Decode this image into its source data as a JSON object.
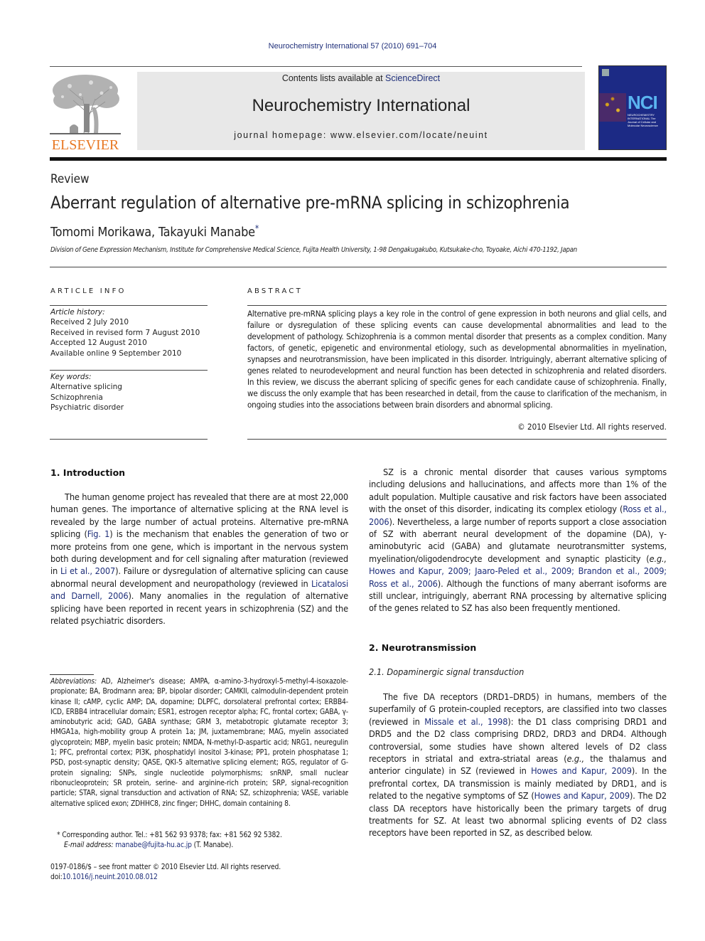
{
  "header": {
    "citation": "Neurochemistry International 57 (2010) 691–704",
    "contents_prefix": "Contents lists available at ",
    "contents_link": "ScienceDirect",
    "journal_title": "Neurochemistry International",
    "homepage": "journal homepage: www.elsevier.com/locate/neuint",
    "publisher_logo_text": "ELSEVIER",
    "cover": {
      "acronym": "NCI",
      "subtitle": "NEUROCHEMISTRY INTERNATIONAL The Journal of Cellular and Molecular Neuroscience"
    }
  },
  "article": {
    "type": "Review",
    "title": "Aberrant regulation of alternative pre-mRNA splicing in schizophrenia",
    "authors": "Tomomi Morikawa, Takayuki Manabe",
    "author_mark": "*",
    "affiliation": "Division of Gene Expression Mechanism, Institute for Comprehensive Medical Science, Fujita Health University, 1-98 Dengakugakubo, Kutsukake-cho, Toyoake, Aichi 470-1192, Japan"
  },
  "article_info": {
    "heading": "ARTICLE INFO",
    "history_label": "Article history:",
    "history": [
      "Received 2 July 2010",
      "Received in revised form 7 August 2010",
      "Accepted 12 August 2010",
      "Available online 9 September 2010"
    ],
    "keywords_label": "Key words:",
    "keywords": [
      "Alternative splicing",
      "Schizophrenia",
      "Psychiatric disorder"
    ]
  },
  "abstract": {
    "heading": "ABSTRACT",
    "text": "Alternative pre-mRNA splicing plays a key role in the control of gene expression in both neurons and glial cells, and failure or dysregulation of these splicing events can cause developmental abnormalities and lead to the development of pathology. Schizophrenia is a common mental disorder that presents as a complex condition. Many factors, of genetic, epigenetic and environmental etiology, such as developmental abnormalities in myelination, synapses and neurotransmission, have been implicated in this disorder. Intriguingly, aberrant alternative splicing of genes related to neurodevelopment and neural function has been detected in schizophrenia and related disorders. In this review, we discuss the aberrant splicing of specific genes for each candidate cause of schizophrenia. Finally, we discuss the only example that has been researched in detail, from the cause to clarification of the mechanism, in ongoing studies into the associations between brain disorders and abnormal splicing.",
    "copyright": "© 2010 Elsevier Ltd. All rights reserved."
  },
  "body": {
    "intro_heading": "1.  Introduction",
    "intro_p1": [
      "The human genome project has revealed that there are at most 22,000 human genes. The importance of alternative splicing at the RNA level is revealed by the large number of actual proteins. Alternative pre-mRNA splicing (",
      "Fig. 1",
      ") is the mechanism that enables the generation of two or more proteins from one gene, which is important in the nervous system both during development and for cell signaling after maturation (reviewed in ",
      "Li et al., 2007",
      "). Failure or dysregulation of alternative splicing can cause abnormal neural development and neuropathology (reviewed in ",
      "Licatalosi and Darnell, 2006",
      "). Many anomalies in the regulation of alternative splicing have been reported in recent years in schizophrenia (SZ) and the related psychiatric disorders."
    ],
    "intro_p2": [
      "SZ is a chronic mental disorder that causes various symptoms including delusions and hallucinations, and affects more than 1% of the adult population. Multiple causative and risk factors have been associated with the onset of this disorder, indicating its complex etiology (",
      "Ross et al., 2006",
      "). Nevertheless, a large number of reports support a close association of SZ with aberrant neural development of the dopamine (DA), γ-aminobutyric acid (GABA) and glutamate neurotransmitter systems, myelination/oligodendrocyte development and synaptic plasticity (",
      "e.g., ",
      "Howes and Kapur, 2009; Jaaro-Peled et al., 2009; Brandon et al., 2009; Ross et al., 2006",
      "). Although the functions of many aberrant isoforms are still unclear, intriguingly, aberrant RNA processing by alternative splicing of the genes related to SZ has also been frequently mentioned."
    ],
    "section2_heading": "2.  Neurotransmission",
    "section21_heading": "2.1.  Dopaminergic signal transduction",
    "s21_p1": [
      "The five DA receptors (DRD1–DRD5) in humans, members of the superfamily of G protein-coupled receptors, are classified into two classes (reviewed in ",
      "Missale et al., 1998",
      "): the D1 class comprising DRD1 and DRD5 and the D2 class comprising DRD2, DRD3 and DRD4. Although controversial, some studies have shown altered levels of D2 class receptors in striatal and extra-striatal areas (",
      "e.g.,",
      " the thalamus and anterior cingulate) in SZ (reviewed in ",
      "Howes and Kapur, 2009",
      "). In the prefrontal cortex, DA transmission is mainly mediated by DRD1, and is related to the negative symptoms of SZ (",
      "Howes and Kapur, 2009",
      "). The D2 class DA receptors have historically been the primary targets of drug treatments for SZ. At least two abnormal splicing events of D2 class receptors have been reported in SZ, as described below."
    ]
  },
  "footnotes": {
    "abbrev_label": "Abbreviations:",
    "abbrev_text": " AD, Alzheimer's disease; AMPA, α-amino-3-hydroxyl-5-methyl-4-isoxazole-propionate; BA, Brodmann area; BP, bipolar disorder; CAMKII, calmodulin-dependent protein kinase II; cAMP, cyclic AMP; DA, dopamine; DLPFC, dorsolateral prefrontal cortex; ERBB4-ICD, ERBB4 intracellular domain; ESR1, estrogen receptor alpha; FC, frontal cortex; GABA, γ-aminobutyric acid; GAD, GABA synthase; GRM 3, metabotropic glutamate receptor 3; HMGA1a, high-mobility group A protein 1a; JM, juxtamembrane; MAG, myelin associated glycoprotein; MBP, myelin basic protein; NMDA, N-methyl-D-aspartic acid; NRG1, neuregulin 1; PFC, prefrontal cortex; PI3K, phosphatidyl inositol 3-kinase; PP1, protein phosphatase 1; PSD, post-synaptic density; QASE, QKI-5 alternative splicing element; RGS, regulator of G-protein signaling; SNPs, single nucleotide polymorphisms; snRNP, small nuclear ribonucleoprotein; SR protein, serine- and arginine-rich protein; SRP, signal-recognition particle; STAR, signal transduction and activation of RNA; SZ, schizophrenia; VASE, variable alternative spliced exon; ZDHHC8, zinc finger; DHHC, domain containing 8.",
    "corresponding": "* Corresponding author. Tel.: +81 562 93 9378; fax: +81 562 92 5382.",
    "email_label": "E-mail address:",
    "email": "manabe@fujita-hu.ac.jp",
    "email_suffix": " (T. Manabe).",
    "front_matter": "0197-0186/$ – see front matter © 2010 Elsevier Ltd. All rights reserved.",
    "doi_prefix": "doi:",
    "doi": "10.1016/j.neuint.2010.08.012"
  },
  "colors": {
    "link": "#1f2f7a",
    "elsevier_orange": "#e87722",
    "banner_bg": "#e8e8e8",
    "cover_blue": "#1c2a85"
  }
}
